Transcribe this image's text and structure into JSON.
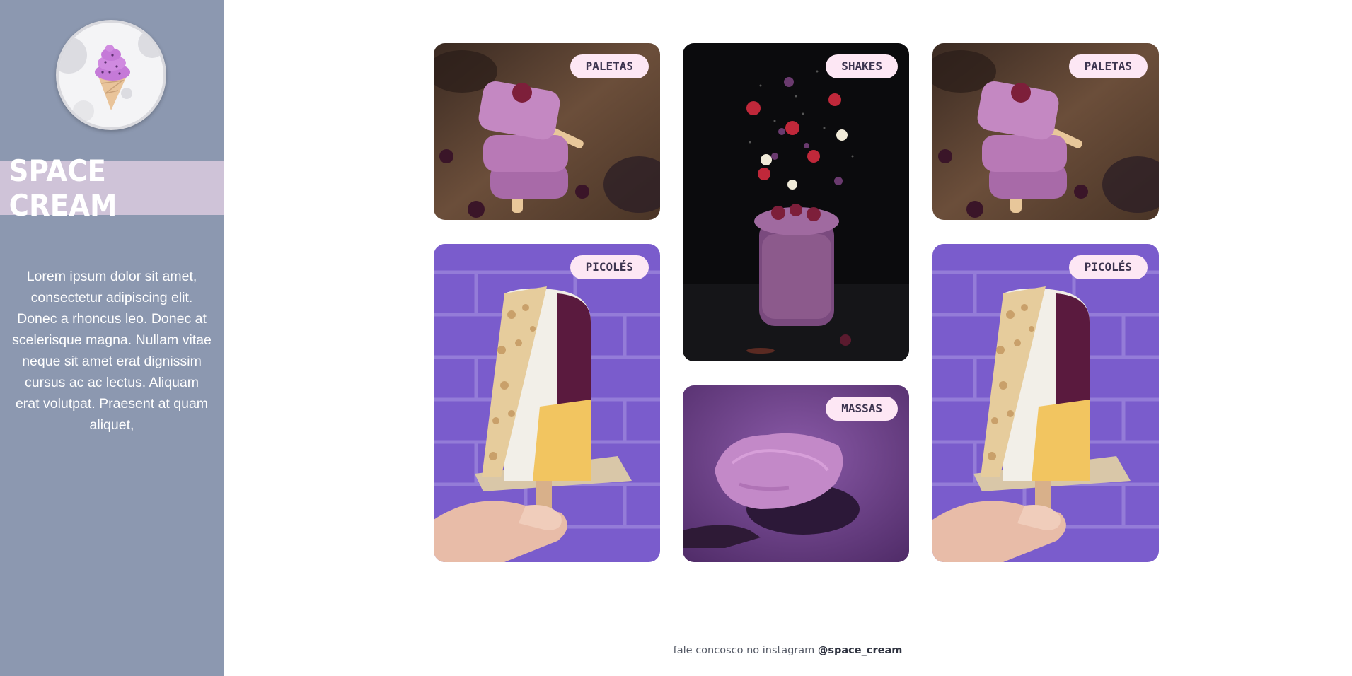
{
  "sidebar": {
    "logo_icon": "ice-cream-cone-icon",
    "brand": "SPACE CREAM",
    "description": "Lorem ipsum dolor sit amet, consectetur adipiscing elit. Donec a rhoncus leo. Donec at scelerisque magna. Nullam vitae neque sit amet erat dignissim cursus ac ac lectus. Aliquam erat volutpat. Praesent at quam aliquet,",
    "colors": {
      "background": "#8c98b0",
      "band": "#cfc3d8"
    }
  },
  "gallery": {
    "cards": [
      {
        "label": "PALETAS",
        "image": "stacked-purple-popsicles"
      },
      {
        "label": "SHAKES",
        "image": "purple-shake-with-flying-berries"
      },
      {
        "label": "PALETAS",
        "image": "stacked-purple-popsicles"
      },
      {
        "label": "PICOLÉS",
        "image": "hand-holding-nut-covered-popsicle"
      },
      {
        "label": "PICOLÉS",
        "image": "hand-holding-nut-covered-popsicle"
      },
      {
        "label": "MASSAS",
        "image": "spoon-of-purple-ice-cream"
      }
    ],
    "tag_color": "#fde7f4"
  },
  "footer": {
    "prefix": "fale concosco no instagram",
    "handle": "@space_cream"
  }
}
